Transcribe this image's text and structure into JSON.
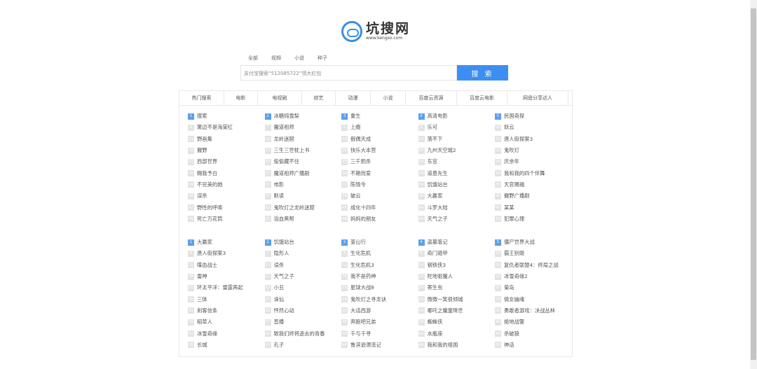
{
  "logo": {
    "title": "坑搜网",
    "url": "www.kengso.com"
  },
  "search_tabs": [
    "全部",
    "视频",
    "小说",
    "种子"
  ],
  "search": {
    "placeholder": "支付宝搜索“512085722”领大红包",
    "button": "搜 索"
  },
  "category_tabs": [
    "热门搜索",
    "电影",
    "电视剧",
    "综艺",
    "动漫",
    "小说",
    "百度云资源",
    "百度云电影",
    "网盘分享达人"
  ],
  "blocks": [
    {
      "columns": [
        [
          "搜索",
          "黉边不是海棠红",
          "野画集",
          "撒野",
          "西部世界",
          "赐我予白",
          "不完美的她",
          "误杀",
          "野性的呼唤",
          "死亡万花筒"
        ],
        [
          "冰糖炖雪梨",
          "魔道祖师",
          "龙岭迷窟",
          "三生三世枕上书",
          "偷偷藏不住",
          "魔道祖师广播剧",
          "电影",
          "默读",
          "鬼吹灯之龙岭迷窟",
          "浴血黑帮"
        ],
        [
          "重生",
          "上瘾",
          "假偶天成",
          "快乐大本营",
          "三千鸦杀",
          "不期而爱",
          "陈情令",
          "破云",
          "成化十四年",
          "妈妈的朋友"
        ],
        [
          "高清电影",
          "乐可",
          "落不下",
          "九州天空城2",
          "东宫",
          "道恩先生",
          "饥饿站台",
          "大赢家",
          "斗罗大陆",
          "天气之子"
        ],
        [
          "民国奇探",
          "妖云",
          "唐人街探案3",
          "鬼吹灯",
          "庆余年",
          "我和我的四个伴舞",
          "天官赐福",
          "撒野广播剧",
          "某某",
          "犯罪心理"
        ]
      ]
    },
    {
      "columns": [
        [
          "大赢家",
          "唐人街探案3",
          "喋血战士",
          "雷神",
          "环太平洋：雷霆再起",
          "三体",
          "刺客信条",
          "稻草人",
          "冰雪奇缘",
          "长城"
        ],
        [
          "饥饿站台",
          "隐形人",
          "误杀",
          "天气之子",
          "小丑",
          "诛仙",
          "怦然心动",
          "直播",
          "致我们终将逝去的青春",
          "孔子"
        ],
        [
          "釜山行",
          "生化危机",
          "生化危机3",
          "我不是药神",
          "星球大战8",
          "鬼吹灯之寻龙诀",
          "大话西游",
          "奔跑吧兄弟",
          "千与千寻",
          "鲁滨逊漂流记"
        ],
        [
          "盗墓笔记",
          "奇门遁甲",
          "钢铁侠3",
          "陀地驱魔人",
          "寄生虫",
          "微微一笑很倾城",
          "哪吒之魔童降世",
          "蜘蛛侠",
          "水瓶座",
          "我和我的祖国"
        ],
        [
          "僵尸世界大战",
          "霸王别姬",
          "复仇者联盟4：终局之战",
          "冰雪奇缘2",
          "菊岛",
          "倩女幽魂",
          "勇敢者游戏：决战丛林",
          "绝地战警",
          "杀破狼",
          "神话"
        ]
      ]
    }
  ],
  "colors": {
    "accent": "#3d8ef2",
    "badge_top": "#5b9ff0",
    "badge": "#e3e3e3"
  }
}
